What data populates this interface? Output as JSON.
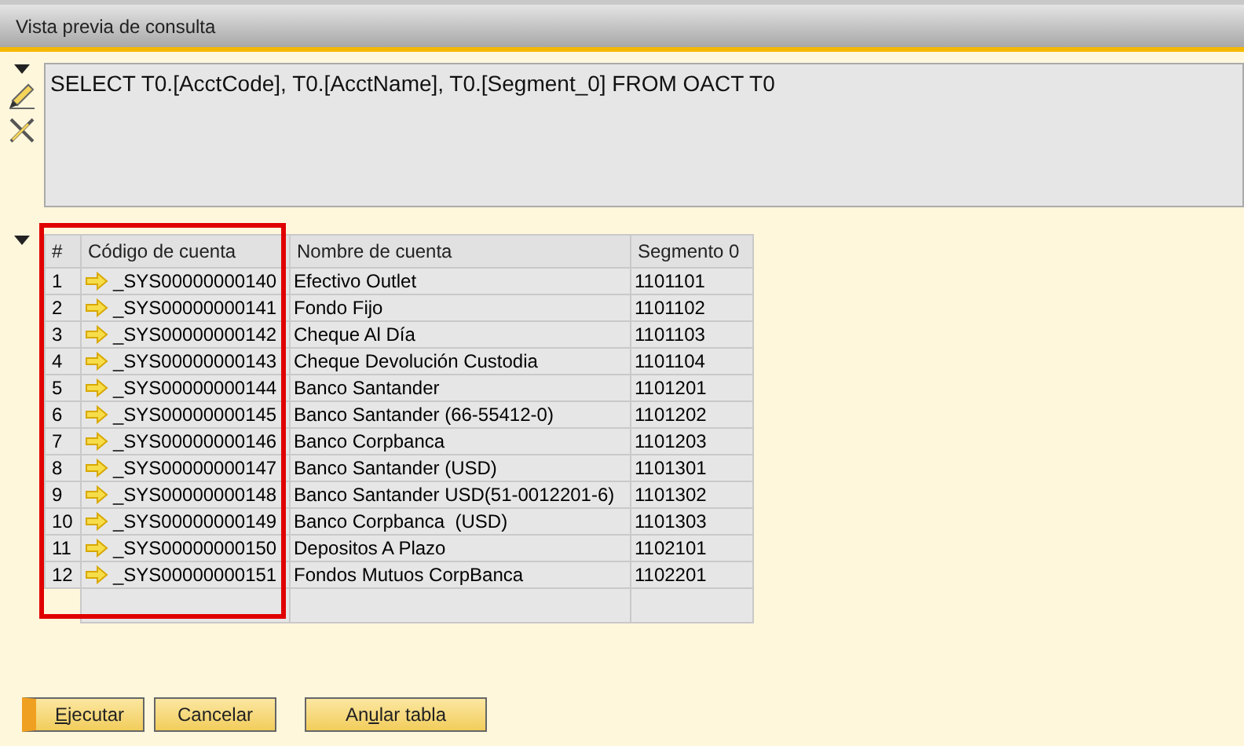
{
  "window": {
    "title": "Vista previa de consulta"
  },
  "query": {
    "text": "SELECT T0.[AcctCode], T0.[AcctName], T0.[Segment_0] FROM OACT T0",
    "expanded": true
  },
  "table": {
    "expanded": true,
    "columns": [
      "#",
      "Código de cuenta",
      "Nombre de cuenta",
      "Segmento 0"
    ],
    "rows": [
      {
        "num": "1",
        "code": "_SYS00000000140",
        "name": "Efectivo Outlet",
        "segment": "1101101"
      },
      {
        "num": "2",
        "code": "_SYS00000000141",
        "name": "Fondo Fijo",
        "segment": "1101102"
      },
      {
        "num": "3",
        "code": "_SYS00000000142",
        "name": "Cheque Al Día",
        "segment": "1101103"
      },
      {
        "num": "4",
        "code": "_SYS00000000143",
        "name": "Cheque Devolución Custodia",
        "segment": "1101104"
      },
      {
        "num": "5",
        "code": "_SYS00000000144",
        "name": "Banco Santander",
        "segment": "1101201"
      },
      {
        "num": "6",
        "code": "_SYS00000000145",
        "name": "Banco Santander (66-55412-0)",
        "segment": "1101202"
      },
      {
        "num": "7",
        "code": "_SYS00000000146",
        "name": "Banco Corpbanca",
        "segment": "1101203"
      },
      {
        "num": "8",
        "code": "_SYS00000000147",
        "name": "Banco Santander (USD)",
        "segment": "1101301"
      },
      {
        "num": "9",
        "code": "_SYS00000000148",
        "name": "Banco Santander USD(51-0012201-6)",
        "segment": "1101302"
      },
      {
        "num": "10",
        "code": "_SYS00000000149",
        "name": "Banco Corpbanca  (USD)",
        "segment": "1101303"
      },
      {
        "num": "11",
        "code": "_SYS00000000150",
        "name": "Depositos A Plazo",
        "segment": "1102101"
      },
      {
        "num": "12",
        "code": "_SYS00000000151",
        "name": "Fondos Mutuos CorpBanca",
        "segment": "1102201"
      }
    ],
    "highlighted_column": true
  },
  "buttons": [
    {
      "parts": [
        {
          "text": "E",
          "underlined": true
        },
        {
          "text": "jecutar",
          "underlined": false
        }
      ],
      "selected": true
    },
    {
      "parts": [
        {
          "text": "Cancelar",
          "underlined": false
        }
      ],
      "selected": false
    },
    {
      "parts": [
        {
          "text": "An",
          "underlined": false
        },
        {
          "text": "u",
          "underlined": true
        },
        {
          "text": "lar tabla",
          "underlined": false
        }
      ],
      "selected": false
    }
  ]
}
